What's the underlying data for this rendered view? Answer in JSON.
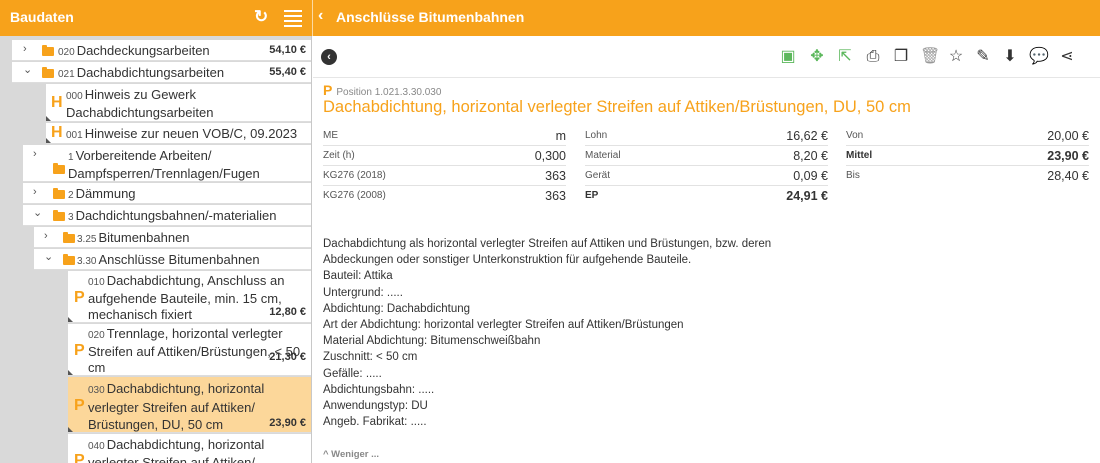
{
  "header": {
    "left_title": "Baudaten",
    "right_title": "Anschlüsse Bitumenbahnen",
    "back_glyph": "‹",
    "refresh_glyph": "↻"
  },
  "tree": {
    "rows": [
      {
        "num": "020",
        "label": "Dachdeckungsarbeiten",
        "price": "54,10 €",
        "chevron": "›"
      },
      {
        "num": "021",
        "label": "Dachabdichtungsarbeiten",
        "price": "55,40 €",
        "chevron": "⌄"
      },
      {
        "letter": "H",
        "num": "000",
        "label_line1": "Hinweis zu Gewerk",
        "label_line2": "Dachabdichtungsarbeiten"
      },
      {
        "letter": "H",
        "num": "001",
        "label": "Hinweise zur neuen VOB/C, 09.2023"
      },
      {
        "num": "1",
        "label_line1": "Vorbereitende Arbeiten/",
        "label_line2": "Dampfsperren/Trennlagen/Fugen",
        "chevron": "›"
      },
      {
        "num": "2",
        "label": "Dämmung",
        "chevron": "›"
      },
      {
        "num": "3",
        "label": "Dachdichtungsbahnen/-materialien",
        "chevron": "⌄"
      },
      {
        "num": "3.25",
        "label": "Bitumenbahnen",
        "chevron": "›"
      },
      {
        "num": "3.30",
        "label": "Anschlüsse Bitumenbahnen",
        "chevron": "⌄"
      },
      {
        "letter": "P",
        "num": "010",
        "label_line1": "Dachabdichtung, Anschluss an",
        "label_line2": "aufgehende Bauteile, min. 15 cm,",
        "label_line3": "mechanisch fixiert",
        "price": "12,80 €"
      },
      {
        "letter": "P",
        "num": "020",
        "label_line1": "Trennlage, horizontal verlegter",
        "label_line2": "Streifen auf Attiken/Brüstungen, < 50",
        "label_line3": "cm",
        "price": "21,30 €"
      },
      {
        "letter": "P",
        "num": "030",
        "label_line1": "Dachabdichtung, horizontal",
        "label_line2": "verlegter Streifen auf Attiken/",
        "label_line3": "Brüstungen, DU, 50 cm",
        "price": "23,90 €",
        "selected": true
      },
      {
        "letter": "P",
        "num": "040",
        "label_line1": "Dachabdichtung, horizontal",
        "label_line2": "verlegter Streifen auf Attiken/"
      }
    ]
  },
  "position": {
    "letter": "P",
    "label": "Position",
    "number": "1.021.3.30.030",
    "title": "Dachabdichtung, horizontal verlegter Streifen auf Attiken/Brüstungen, DU, 50 cm"
  },
  "details": {
    "col1": [
      {
        "k": "ME",
        "v": "m"
      },
      {
        "k": "Zeit (h)",
        "v": "0,300"
      },
      {
        "k": "KG276 (2018)",
        "v": "363"
      },
      {
        "k": "KG276 (2008)",
        "v": "363"
      }
    ],
    "col2": [
      {
        "k": "Lohn",
        "v": "16,62 €"
      },
      {
        "k": "Material",
        "v": "8,20 €"
      },
      {
        "k": "Gerät",
        "v": "0,09 €"
      },
      {
        "k": "EP",
        "v": "24,91 €",
        "bold": true
      }
    ],
    "col3": [
      {
        "k": "Von",
        "v": "20,00 €"
      },
      {
        "k": "Mittel",
        "v": "23,90 €",
        "bold": true
      },
      {
        "k": "Bis",
        "v": "28,40 €"
      }
    ]
  },
  "description": [
    "Dachabdichtung als horizontal verlegter Streifen auf Attiken und Brüstungen, bzw. deren",
    "Abdeckungen oder sonstiger Unterkonstruktion für aufgehende Bauteile.",
    "Bauteil: Attika",
    "Untergrund: .....",
    "Abdichtung: Dachabdichtung",
    "Art der Abdichtung: horizontal verlegter Streifen auf Attiken/Brüstungen",
    "Material Abdichtung: Bitumenschweißbahn",
    "Zuschnitt: < 50 cm",
    "Gefälle: .....",
    "Abdichtungsbahn: .....",
    "Anwendungstyp: DU",
    "Angeb. Fabrikat: ....."
  ],
  "less_label": "^ Weniger ...",
  "colors": {
    "accent": "#f7a21b",
    "selected_row": "#fcd79a",
    "toolbar_green": "#5cb85c"
  }
}
